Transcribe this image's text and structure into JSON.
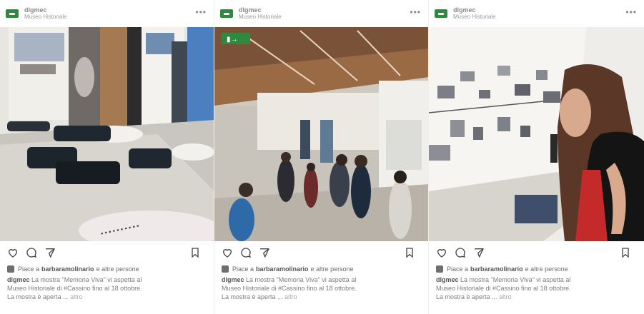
{
  "brand_color": "#2e8b3e",
  "posts": [
    {
      "username": "dlgmec",
      "location": "Museo Historiale",
      "more": "•••",
      "likes_prefix": "Piace a",
      "likes_user": "barbaramolinario",
      "likes_suffix": "e altre persone",
      "caption_user": "dlgmec",
      "caption_l1": "La mostra \"Memoria Viva\" vi aspetta al",
      "caption_l2": "Museo Historiale di #Cassino fino al 18 ottobre.",
      "caption_l3": "La mostra è aperta ...",
      "caption_more": "altro"
    },
    {
      "username": "dlgmec",
      "location": "Museo Historiale",
      "more": "•••",
      "likes_prefix": "Piace a",
      "likes_user": "barbaramolinario",
      "likes_suffix": "e altre persone",
      "caption_user": "dlgmec",
      "caption_l1": "La mostra \"Memoria Viva\" vi aspetta al",
      "caption_l2": "Museo Historiale di #Cassino fino al 18 ottobre.",
      "caption_l3": "La mostra è aperta ...",
      "caption_more": "altro"
    },
    {
      "username": "dlgmec",
      "location": "Museo Historiale",
      "more": "•••",
      "likes_prefix": "Piace a",
      "likes_user": "barbaramolinario",
      "likes_suffix": "e altre persone",
      "caption_user": "dlgmec",
      "caption_l1": "La mostra \"Memoria Viva\" vi aspetta al",
      "caption_l2": "Museo Historiale di #Cassino fino al 18 ottobre.",
      "caption_l3": "La mostra è aperta ...",
      "caption_more": "altro"
    }
  ]
}
